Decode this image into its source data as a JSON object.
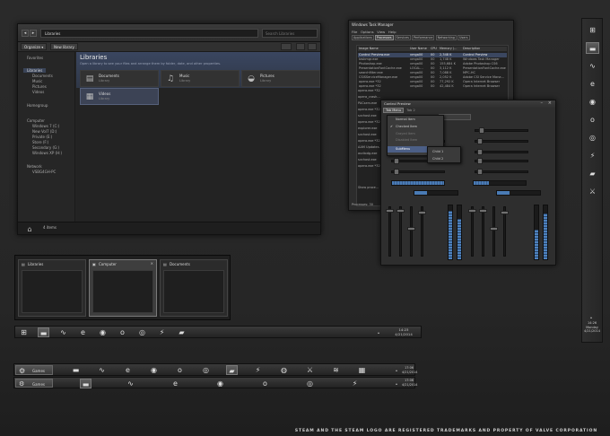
{
  "explorer": {
    "breadcrumb": "Libraries",
    "search_placeholder": "Search Libraries",
    "organize": "Organize ▾",
    "new_library": "New library",
    "nav": {
      "favorites": "Favorites",
      "libraries": "Libraries",
      "lib_items": [
        "Documents",
        "Music",
        "Pictures",
        "Videos"
      ],
      "homegroup": "Homegroup",
      "computer": "Computer",
      "drives": [
        "Windows 7 (C:)",
        "New Vol7 (D:)",
        "Private (E:)",
        "Store (F:)",
        "Secondary (G:)",
        "Windows XP (H:)"
      ],
      "network": "Network",
      "pc": "VSBG4GH-PC"
    },
    "header_title": "Libraries",
    "header_subtitle": "Open a library to see your files and arrange them by folder, date, and other properties.",
    "tiles": [
      {
        "name": "Documents",
        "sub": "Library",
        "icon": "▤"
      },
      {
        "name": "Music",
        "sub": "Library",
        "icon": "♫"
      },
      {
        "name": "Pictures",
        "sub": "Library",
        "icon": "◒"
      },
      {
        "name": "Videos",
        "sub": "Library",
        "icon": "▦"
      }
    ],
    "status": "4 items"
  },
  "taskmanager": {
    "title": "Windows Task Manager",
    "menus": [
      "File",
      "Options",
      "View",
      "Help"
    ],
    "tabs": [
      "Applications",
      "Processes",
      "Services",
      "Performance",
      "Networking",
      "Users"
    ],
    "columns": [
      "Image Name",
      "User Name",
      "CPU",
      "Memory (...",
      "Description"
    ],
    "rows": [
      [
        "Control Preview.exe",
        "vmga00",
        "00",
        "2,348 K",
        "Control Preview"
      ],
      [
        "taskmgr.exe",
        "vmga00",
        "00",
        "1,748 K",
        "Windows Task Manager"
      ],
      [
        "Photoshop.exe",
        "vmga00",
        "00",
        "155,684 K",
        "Adobe Photoshop CS6"
      ],
      [
        "PresentationFontCache.exe",
        "LOCAL...",
        "00",
        "3,112 K",
        "PresentationFontCache.exe"
      ],
      [
        "searchfilter.exe",
        "vmga00",
        "00",
        "7,088 K",
        "MPC-HC"
      ],
      [
        "CSISServiceManager.exe",
        "vmga00",
        "00",
        "2,052 K",
        "Adobe CSI Service Mana..."
      ],
      [
        "opera.exe *32",
        "vmga00",
        "00",
        "77,292 K",
        "Opera Internet Browser"
      ],
      [
        "opera.exe *32",
        "vmga00",
        "00",
        "42,484 K",
        "Opera Internet Browser"
      ]
    ],
    "extra_rows": [
      "opera.exe *32",
      "opera_crash...",
      "PACserv.exe",
      "opera.exe *32",
      "svchost.exe",
      "opera.exe *32",
      "explorer.exe",
      "svchost.exe",
      "opera.exe *32",
      "AAM Updates...",
      "audiodg.exe",
      "svchost.exe",
      "opera.exe *32"
    ],
    "show_all": "Show proce...",
    "processes": "Processes: 30"
  },
  "preview": {
    "title": "Control Preview",
    "tabs": [
      "Tab Menu",
      "Tab 2",
      "Tab 3"
    ],
    "menu_items": [
      "Normal Item",
      "Checked Item",
      "Grayed Item",
      "Disabled Item",
      "SubMenu"
    ],
    "sub_items": [
      "Child 1",
      "Child 2"
    ]
  },
  "thumbnails": [
    {
      "title": "Libraries",
      "icon": "▤"
    },
    {
      "title": "Computer",
      "icon": "▣"
    },
    {
      "title": "Documents",
      "icon": "▤"
    }
  ],
  "taskbar1": {
    "icons": [
      "⊞",
      "▬",
      "∿",
      "e",
      "◉",
      "o",
      "◎",
      "⚡",
      "▰"
    ],
    "time": "14:23",
    "date": "4/21/2014"
  },
  "taskbar2": {
    "label": "Games",
    "icons": [
      "▬",
      "∿",
      "e",
      "◉",
      "o",
      "◎",
      "▰",
      "⚡",
      "◍",
      "⚔",
      "≋",
      "▦"
    ],
    "time": "17:06",
    "date": "4/21/2014"
  },
  "taskbar3": {
    "label": "Games",
    "icons": [
      "▬",
      "∿",
      "e",
      "◉",
      "o",
      "◎",
      "⚡"
    ],
    "time": "17:06",
    "date": "4/21/2014"
  },
  "vtaskbar": {
    "icons": [
      "⊞",
      "▬",
      "∿",
      "e",
      "◉",
      "o",
      "◎",
      "⚡",
      "▰",
      "⚔"
    ],
    "time": "14:26",
    "day": "Monday",
    "date": "4/21/2014"
  },
  "footer": "STEAM AND THE STEAM LOGO ARE REGISTERED TRADEMARKS AND PROPERTY OF VALVE CORPORATION"
}
